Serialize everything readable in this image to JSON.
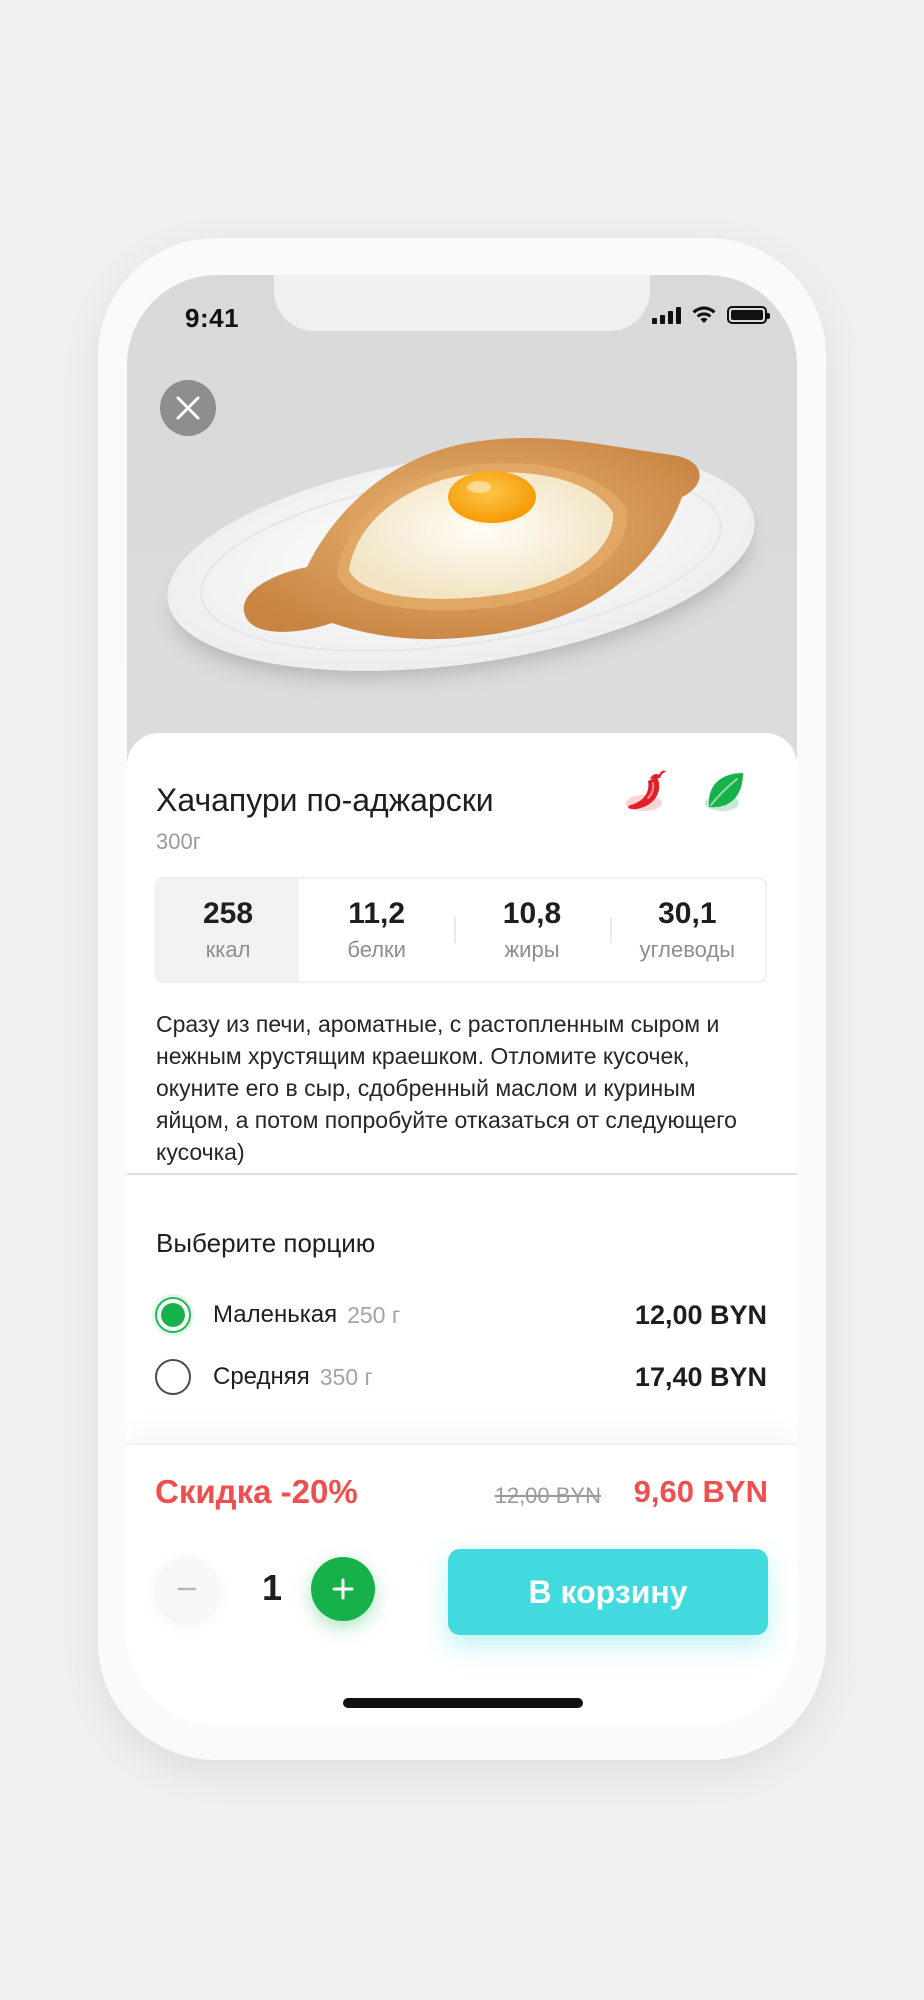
{
  "status_bar": {
    "time": "9:41"
  },
  "product": {
    "name": "Хачапури по-аджарски",
    "weight": "300г",
    "tags": [
      "chili-pepper-icon",
      "leaf-icon"
    ],
    "nutrition": [
      {
        "value": "258",
        "label": "ккал",
        "active": true
      },
      {
        "value": "11,2",
        "label": "белки"
      },
      {
        "value": "10,8",
        "label": "жиры"
      },
      {
        "value": "30,1",
        "label": "углеводы"
      }
    ],
    "description": "Сразу из печи, ароматные, с растопленным сыром и нежным хрустящим краешком. Отломите кусочек, окуните его в сыр, сдобренный маслом и куриным яйцом, а потом попробуйте отказаться от следующего кусочка)"
  },
  "portion": {
    "title": "Выберите порцию",
    "options": [
      {
        "name": "Маленькая",
        "weight": "250 г",
        "price": "12,00 BYN",
        "selected": true
      },
      {
        "name": "Средняя",
        "weight": "350 г",
        "price": "17,40 BYN",
        "selected": false
      }
    ]
  },
  "checkout": {
    "discount_label": "Скидка -20%",
    "old_price": "12,00 BYN",
    "new_price": "9,60 BYN",
    "quantity": "1",
    "add_to_cart_label": "В корзину"
  },
  "colors": {
    "accent_green": "#16b14a",
    "accent_cyan": "#41dbdf",
    "discount_red": "#ef4f4f"
  }
}
